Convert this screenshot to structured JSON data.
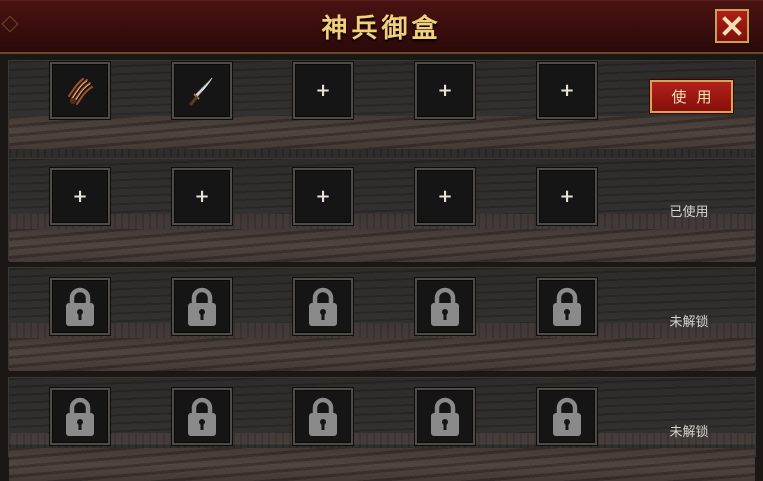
{
  "window": {
    "title": "神兵御盒",
    "close_icon": "close-icon"
  },
  "rows": [
    {
      "slots": [
        {
          "state": "item",
          "icon": "claw-icon"
        },
        {
          "state": "item",
          "icon": "blade-icon"
        },
        {
          "state": "empty",
          "symbol": "+"
        },
        {
          "state": "empty",
          "symbol": "+"
        },
        {
          "state": "empty",
          "symbol": "+"
        }
      ],
      "action_label": "使用"
    },
    {
      "slots": [
        {
          "state": "empty",
          "symbol": "+"
        },
        {
          "state": "empty",
          "symbol": "+"
        },
        {
          "state": "empty",
          "symbol": "+"
        },
        {
          "state": "empty",
          "symbol": "+"
        },
        {
          "state": "empty",
          "symbol": "+"
        }
      ],
      "status_label": "已使用"
    },
    {
      "slots": [
        {
          "state": "locked",
          "icon": "lock-icon"
        },
        {
          "state": "locked",
          "icon": "lock-icon"
        },
        {
          "state": "locked",
          "icon": "lock-icon"
        },
        {
          "state": "locked",
          "icon": "lock-icon"
        },
        {
          "state": "locked",
          "icon": "lock-icon"
        }
      ],
      "status_label": "未解锁"
    },
    {
      "slots": [
        {
          "state": "locked",
          "icon": "lock-icon"
        },
        {
          "state": "locked",
          "icon": "lock-icon"
        },
        {
          "state": "locked",
          "icon": "lock-icon"
        },
        {
          "state": "locked",
          "icon": "lock-icon"
        },
        {
          "state": "locked",
          "icon": "lock-icon"
        }
      ],
      "status_label": "未解锁"
    }
  ],
  "colors": {
    "title": "#f2cf7a",
    "accent_red": "#b3201a",
    "gold_border": "#d7a55a"
  }
}
